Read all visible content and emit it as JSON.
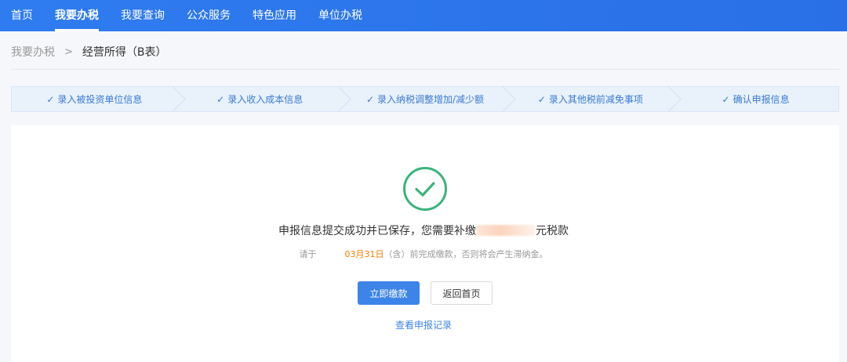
{
  "topnav": {
    "items": [
      {
        "label": "首页",
        "active": false
      },
      {
        "label": "我要办税",
        "active": true
      },
      {
        "label": "我要查询",
        "active": false
      },
      {
        "label": "公众服务",
        "active": false
      },
      {
        "label": "特色应用",
        "active": false
      },
      {
        "label": "单位办税",
        "active": false
      }
    ]
  },
  "breadcrumb": {
    "parent": "我要办税",
    "separator": ">",
    "current": "经营所得（B表）"
  },
  "steps": [
    {
      "check": "✓",
      "label": "录入被投资单位信息"
    },
    {
      "check": "✓",
      "label": "录入收入成本信息"
    },
    {
      "check": "✓",
      "label": "录入纳税调整增加/减少额"
    },
    {
      "check": "✓",
      "label": "录入其他税前减免事项"
    },
    {
      "check": "✓",
      "label": "确认申报信息"
    }
  ],
  "result": {
    "icon": "check-circle-icon",
    "icon_color": "#3bb37a",
    "message_prefix": "申报信息提交成功并已保存，您需要补缴",
    "message_suffix": "元税款",
    "sub_prefix": "请于",
    "deadline": "03月31日",
    "sub_suffix": "（含）前完成缴款，否则将会产生滞纳金。"
  },
  "actions": {
    "pay_now": "立即缴款",
    "back_home": "返回首页",
    "view_records": "查看申报记录"
  },
  "colors": {
    "nav_bg": "#2f7cf0",
    "primary": "#3d84e8",
    "deadline": "#f57c00",
    "step_text": "#3a7bd5"
  }
}
